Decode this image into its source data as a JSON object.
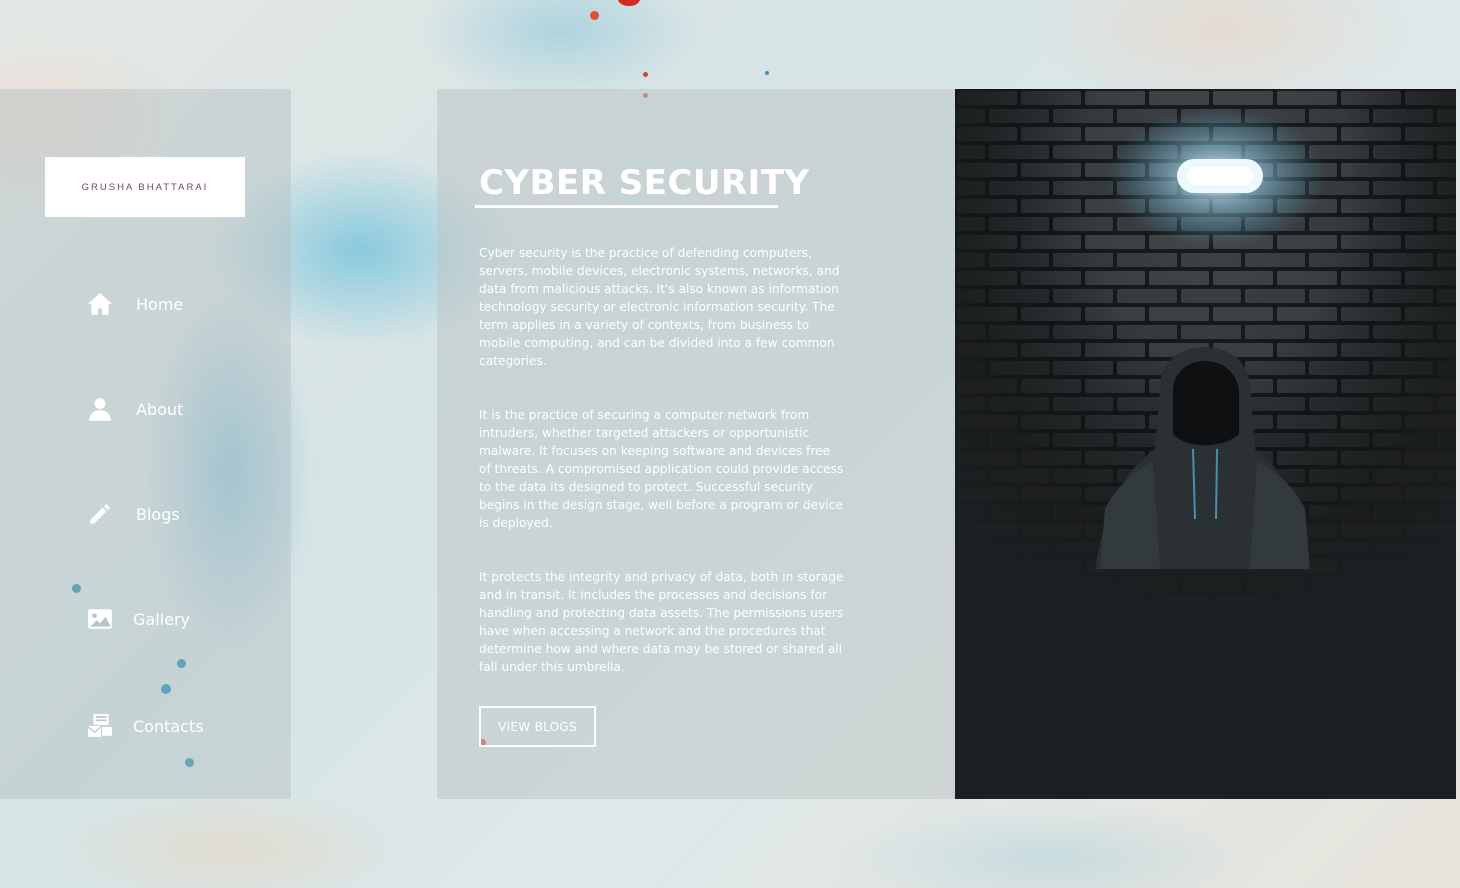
{
  "brand": {
    "logo_text": "GRUSHA BHATTARAI"
  },
  "nav": {
    "items": [
      {
        "label": "Home",
        "icon": "home-icon"
      },
      {
        "label": "About",
        "icon": "user-icon"
      },
      {
        "label": "Blogs",
        "icon": "pencil-icon"
      },
      {
        "label": "Gallery",
        "icon": "image-icon"
      },
      {
        "label": "Contacts",
        "icon": "contacts-icon"
      }
    ]
  },
  "main": {
    "title": "CYBER SECURITY",
    "paragraphs": [
      "Cyber security is the practice of defending computers, servers, mobile devices, electronic systems, networks, and data from malicious attacks. It's also known as information technology security or electronic information security. The term applies in a variety of contexts, from business to mobile computing, and can be divided into a few common categories.",
      "It is the practice of securing a computer network from intruders, whether targeted attackers or opportunistic malware. It focuses on keeping software and devices free of threats. A compromised application could provide access to the data its designed to protect. Successful security begins in the design stage, well before a program or device is deployed.",
      "It protects the integrity and privacy of data, both in storage and in transit. It includes the processes and decisions for handling and protecting data assets. The permissions users have when accessing a network and the procedures that determine how and where data may be stored or shared all fall under this umbrella."
    ],
    "button_label": "VIEW BLOGS"
  },
  "photo": {
    "subject": "hooded-figure-under-lamp"
  },
  "colors": {
    "accent": "#ffffff",
    "panel_dark": "#1d2022",
    "logo_text": "#6b4d49"
  }
}
